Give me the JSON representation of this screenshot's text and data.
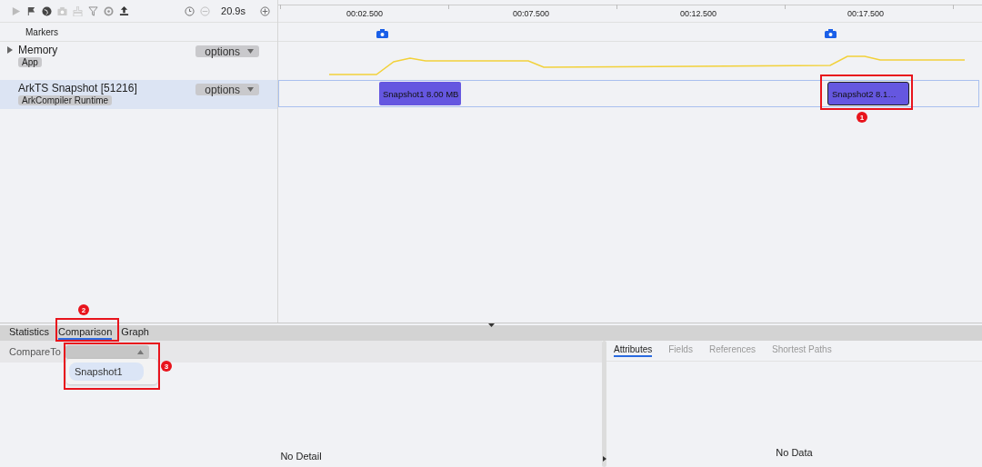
{
  "toolbar": {
    "duration": "20.9s"
  },
  "timeline": {
    "ticks": [
      "00:02.500",
      "00:07.500",
      "00:12.500",
      "00:17.500"
    ]
  },
  "markers_label": "Markers",
  "tracks": [
    {
      "name": "Memory",
      "tag": "App",
      "options": "options",
      "expandable": true,
      "selected": false
    },
    {
      "name": "ArkTS Snapshot [51216]",
      "tag": "ArkCompiler Runtime",
      "options": "options",
      "expandable": false,
      "selected": true
    }
  ],
  "snapshots": [
    {
      "label": "Snapshot1 8.00 MB",
      "selected": false
    },
    {
      "label": "Snapshot2 8.1…",
      "selected": true
    }
  ],
  "bottom_tabs": [
    {
      "label": "Statistics",
      "selected": false
    },
    {
      "label": "Comparison",
      "selected": true
    },
    {
      "label": "Graph",
      "selected": false
    }
  ],
  "compare": {
    "label": "CompareTo",
    "options": [
      {
        "label": "Snapshot1",
        "selected": true
      }
    ]
  },
  "detail_tabs": [
    {
      "label": "Attributes",
      "selected": true
    },
    {
      "label": "Fields",
      "selected": false
    },
    {
      "label": "References",
      "selected": false
    },
    {
      "label": "Shortest Paths",
      "selected": false
    }
  ],
  "left_empty": "No Detail",
  "right_empty": "No Data",
  "callouts": [
    "1",
    "2",
    "3"
  ]
}
